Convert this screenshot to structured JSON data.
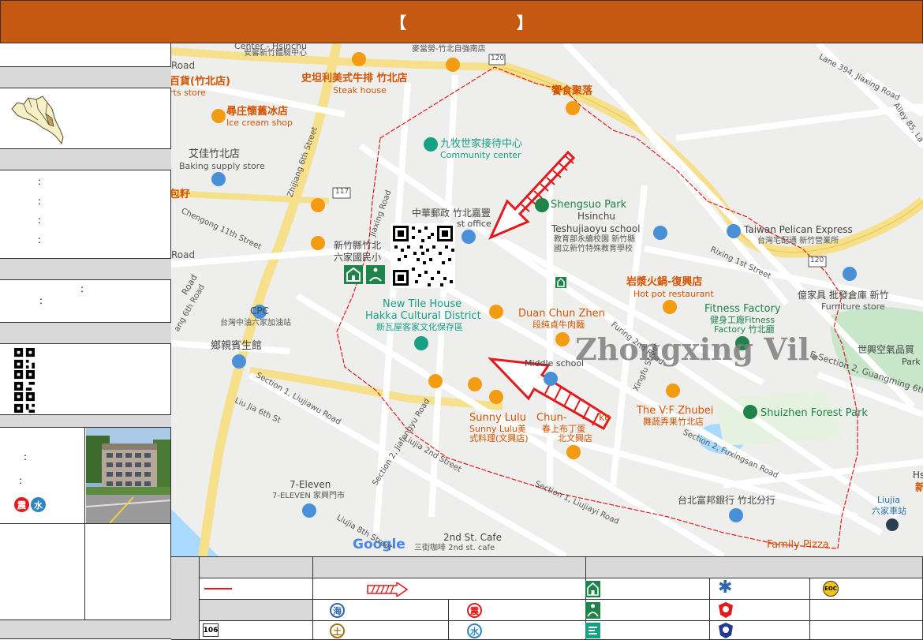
{
  "header": {
    "bracket_open": "【",
    "bracket_close": "】"
  },
  "sidebar": {
    "info_lines": [
      ":",
      ":",
      ":",
      ":"
    ],
    "contact_lines": [
      ":",
      ":"
    ],
    "shelter_lines": [
      ":",
      ":"
    ],
    "hazard_icons": [
      "震",
      "水"
    ]
  },
  "map": {
    "village_name": "Zhongxing Vil.",
    "labels": {
      "kids_center_en": "安馨新竹體驗中心",
      "center_top": "Center - Hsinchu",
      "mcd": "麥當勞-竹北自強南店",
      "steak_cn": "史坦利美式牛排 竹北店",
      "steak_en": "Steak house",
      "dept_cn": "百貨(竹北店)",
      "dept_en": "rts store",
      "ice_cn": "尋庄懷舊冰店",
      "ice_en": "Ice cream shop",
      "baking_cn": "艾佳竹北店",
      "baking_en": "Baking supply store",
      "gourmet": "饗食聚落",
      "community_cn": "九牧世家接待中心",
      "community_en": "Community center",
      "post_cn": "中華郵政 竹北嘉豐",
      "post_en": "st office",
      "shengsuo": "Shengsuo Park",
      "hsinchu": "Hsinchu",
      "teshu": "Teshujiaoyu school",
      "teshu_cn1": "教育部永續校園 新竹縣",
      "teshu_cn2": "國立新竹特殊教育學校",
      "pelican": "Taiwan Pelican Express",
      "pelican_cn": "台灣宅配通 新竹營業所",
      "school_cn1": "新竹縣竹北",
      "school_cn2": "六家國民小",
      "hotpot_cn": "岩漿火鍋-復興店",
      "hotpot_en": "Hot pot restaurant",
      "furniture_cn": "億家具 批發倉庫 新竹",
      "furniture_en": "Furniture store",
      "newtile_en1": "New Tile House",
      "newtile_en2": "Hakka Cultural District",
      "newtile_cn": "新瓦屋客家文化保存區",
      "duan_en": "Duan Chun Zhen",
      "duan_cn": "段純貞牛肉麵",
      "fitness_en": "Fitness Factory",
      "fitness_cn1": "健身工廠Fitness",
      "fitness_cn2": "Factory 竹北廳",
      "cpc": "CPC",
      "cpc_cn": "台灣中油六家加油站",
      "hotel_cn": "鄉親賓生館",
      "middle": "Middle school",
      "expo_cn": "世興空氣品質",
      "park": "Park",
      "sunny_en": "Sunny Lulu",
      "sunny_cn1": "Sunny Lulu美",
      "sunny_cn2": "式料理(文興店)",
      "chun": "Chun-",
      "chun_ke": "ke",
      "chun_cn": "春上布丁蛋",
      "chun_cn2": "北文興店",
      "vf_en": "The V:F Zhubei",
      "vf_cn": "舞蔬弄果竹北店",
      "shuizhen": "Shuizhen Forest Park",
      "seven_en": "7-Eleven",
      "seven_cn": "7-ELEVEN 家興門市",
      "bank": "台北富邦銀行 竹北分行",
      "liujia": "Liujia",
      "liujia_cn": "六家車站",
      "cafe_en": "2nd St. Cafe",
      "cafe_cn": "三街咖啡 2nd st. cafe",
      "family": "Family Pizza",
      "hsi": "Hsi",
      "hsi_cn": "新",
      "google": "Google",
      "route120a": "120",
      "route120b": "120",
      "route117": "117",
      "road_label_1": "Lane 394, Jiaxing Road",
      "road_label_2": "Alley 85, La",
      "road_label_3": "Rixing 1st Street",
      "road_label_4": "E-Section 2, Guangming 6th",
      "road_label_5": "Section 2, Fuxingsan Road",
      "road_label_6": "Section 1, Liujiayi Road",
      "road_label_7": "Section 2, Jiafengyu Road",
      "road_label_8": "Liujia 2nd Street",
      "road_label_9": "Liujia 8th Street",
      "road_label_10": "Section 1, Liujiawu Road",
      "road_label_11": "Liu Jia 6th St",
      "road_label_12": "Zhijiang 6th Street",
      "road_label_13": "Chengong 11th Street",
      "road_label_14": "Jiaxing Road",
      "road_label_15": "Furing 2nd Road",
      "road_label_16": "Xingfu Street",
      "road_label_17": "Road",
      "road_label_18": "Road",
      "road_label_19": "Road",
      "road_label_20": "ang 6th Road",
      "road_label_21": "包籽",
      "road_label_22": "Section 1, Liujia",
      "road_label_23": "Section 1, Liujiayi Road"
    }
  },
  "legend": {
    "route_label": "106",
    "icons": {
      "hai": "海",
      "zhen": "震",
      "tu": "土",
      "shui": "水",
      "eoc": "EOC"
    }
  },
  "colors": {
    "header_bg": "#C65911",
    "arrow_red": "#e31a1c",
    "boundary": "#e31a1c",
    "road_yellow": "#f7e08c",
    "green_icon": "#1e8449"
  }
}
